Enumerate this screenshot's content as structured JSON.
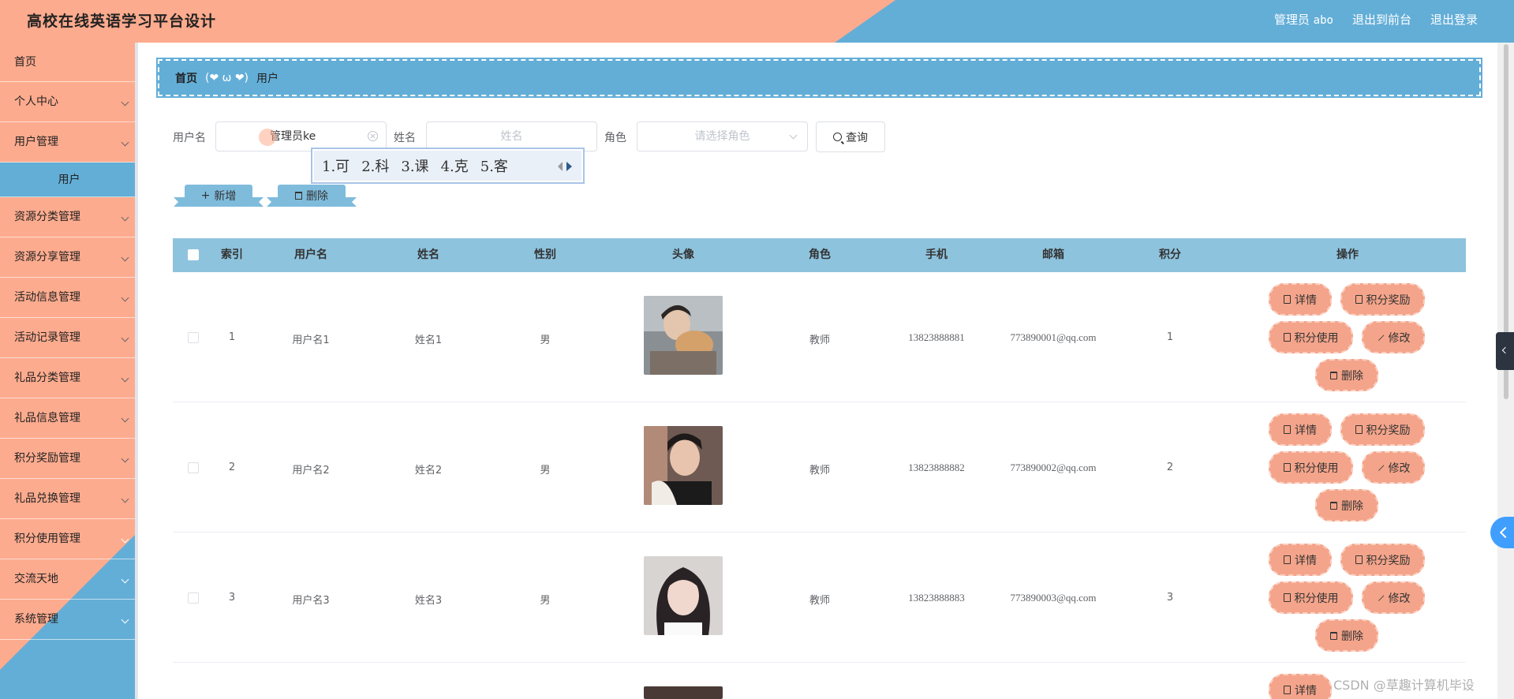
{
  "header": {
    "title": "高校在线英语学习平台设计",
    "user_role": "管理员",
    "user_name": "abo",
    "back_to_front": "退出到前台",
    "logout": "退出登录"
  },
  "sidebar": {
    "items": [
      {
        "label": "首页"
      },
      {
        "label": "个人中心"
      },
      {
        "label": "用户管理"
      },
      {
        "label": "用户"
      },
      {
        "label": "资源分类管理"
      },
      {
        "label": "资源分享管理"
      },
      {
        "label": "活动信息管理"
      },
      {
        "label": "活动记录管理"
      },
      {
        "label": "礼品分类管理"
      },
      {
        "label": "礼品信息管理"
      },
      {
        "label": "积分奖励管理"
      },
      {
        "label": "礼品兑换管理"
      },
      {
        "label": "积分使用管理"
      },
      {
        "label": "交流天地"
      },
      {
        "label": "系统管理"
      }
    ]
  },
  "breadcrumb": {
    "home": "首页",
    "separator": "(❤ ω ❤)",
    "current": "用户"
  },
  "search": {
    "username_label": "用户名",
    "username_value": "管理员ke",
    "name_label": "姓名",
    "name_placeholder": "姓名",
    "role_label": "角色",
    "role_placeholder": "请选择角色",
    "query_button": "查询"
  },
  "ime": {
    "candidates": [
      "1.可",
      "2.科",
      "3.课",
      "4.克",
      "5.客"
    ]
  },
  "actions": {
    "add": "新增",
    "delete": "删除"
  },
  "table": {
    "columns": [
      "索引",
      "用户名",
      "姓名",
      "性别",
      "头像",
      "角色",
      "手机",
      "邮箱",
      "积分",
      "操作"
    ],
    "rows": [
      {
        "index": "1",
        "username": "用户名1",
        "name": "姓名1",
        "gender": "男",
        "role": "教师",
        "phone": "13823888881",
        "email": "773890001@qq.com",
        "points": "1"
      },
      {
        "index": "2",
        "username": "用户名2",
        "name": "姓名2",
        "gender": "男",
        "role": "教师",
        "phone": "13823888882",
        "email": "773890002@qq.com",
        "points": "2"
      },
      {
        "index": "3",
        "username": "用户名3",
        "name": "姓名3",
        "gender": "男",
        "role": "教师",
        "phone": "13823888883",
        "email": "773890003@qq.com",
        "points": "3"
      }
    ],
    "ops": {
      "detail": "详情",
      "reward": "积分奖励",
      "use": "积分使用",
      "edit": "修改",
      "delete": "删除"
    },
    "partial_row_detail": "详情"
  },
  "watermark": "CSDN @草趣计算机毕设",
  "colors": {
    "salmon": "#fdab8e",
    "blue": "#63aed7",
    "table_header": "#8ec3de",
    "op_button": "#f4a48a"
  }
}
